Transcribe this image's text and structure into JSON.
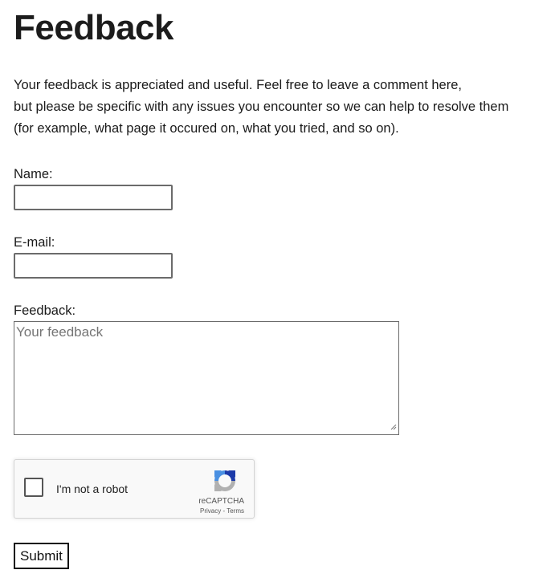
{
  "page": {
    "title": "Feedback",
    "intro_lines": [
      "Your feedback is appreciated and useful. Feel free to leave a comment here,",
      "but please be specific with any issues you encounter so we can help to resolve them",
      "(for example, what page it occured on, what you tried, and so on)."
    ]
  },
  "form": {
    "name_label": "Name:",
    "name_value": "",
    "email_label": "E-mail:",
    "email_value": "",
    "feedback_label": "Feedback:",
    "feedback_placeholder": "Your feedback",
    "submit_label": "Submit"
  },
  "captcha": {
    "checkbox_label": "I'm not a robot",
    "brand": "reCAPTCHA",
    "privacy_link": "Privacy",
    "separator": " - ",
    "terms_link": "Terms",
    "icon": "recaptcha-logo-icon",
    "colors": {
      "blue": "#4a90e2",
      "dark_blue": "#1c3aa9",
      "grey": "#b1b1b1"
    }
  }
}
